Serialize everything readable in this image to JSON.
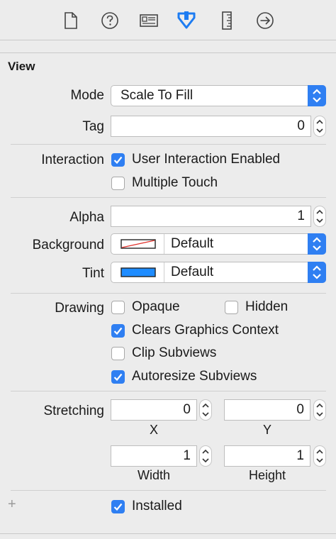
{
  "toolbar": {
    "tabs": [
      {
        "icon": "file-inspector-icon"
      },
      {
        "icon": "quick-help-icon"
      },
      {
        "icon": "identity-inspector-icon"
      },
      {
        "icon": "attributes-inspector-icon",
        "selected": true
      },
      {
        "icon": "size-inspector-icon"
      },
      {
        "icon": "connections-inspector-icon"
      }
    ]
  },
  "view": {
    "title": "View",
    "mode": {
      "label": "Mode",
      "value": "Scale To Fill"
    },
    "tag": {
      "label": "Tag",
      "value": "0"
    },
    "interaction": {
      "label": "Interaction",
      "user_interaction_enabled": {
        "label": "User Interaction Enabled",
        "checked": true
      },
      "multiple_touch": {
        "label": "Multiple Touch",
        "checked": false
      }
    },
    "alpha": {
      "label": "Alpha",
      "value": "1"
    },
    "background": {
      "label": "Background",
      "value": "Default",
      "swatch": "none"
    },
    "tint": {
      "label": "Tint",
      "value": "Default",
      "swatch": "#1e8cff"
    },
    "drawing": {
      "label": "Drawing",
      "opaque": {
        "label": "Opaque",
        "checked": false
      },
      "hidden": {
        "label": "Hidden",
        "checked": false
      },
      "clears_graphics_context": {
        "label": "Clears Graphics Context",
        "checked": true
      },
      "clip_subviews": {
        "label": "Clip Subviews",
        "checked": false
      },
      "autoresize_subviews": {
        "label": "Autoresize Subviews",
        "checked": true
      }
    },
    "stretching": {
      "label": "Stretching",
      "x": {
        "label": "X",
        "value": "0"
      },
      "y": {
        "label": "Y",
        "value": "0"
      },
      "width": {
        "label": "Width",
        "value": "1"
      },
      "height": {
        "label": "Height",
        "value": "1"
      }
    },
    "installed": {
      "label": "Installed",
      "checked": true
    },
    "add_symbol": "+"
  },
  "colors": {
    "accent": "#2f7ff2",
    "tint_swatch": "#1e8cff"
  }
}
